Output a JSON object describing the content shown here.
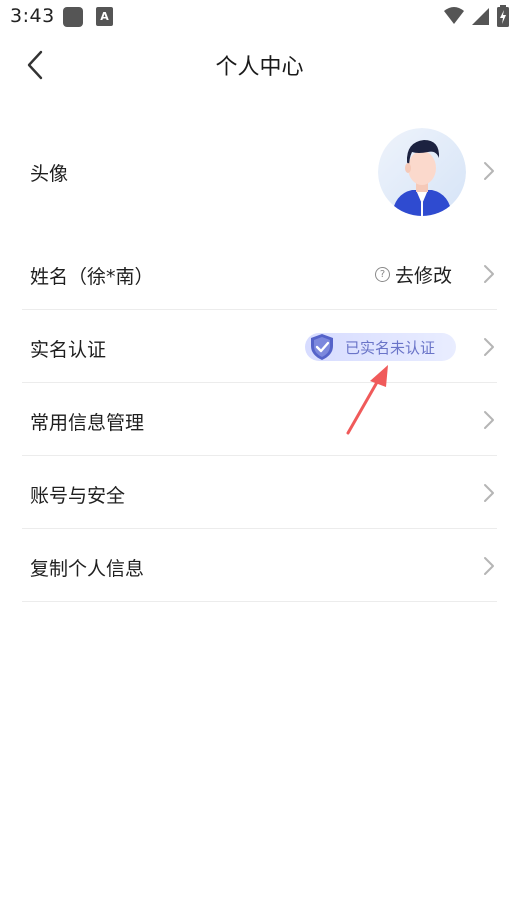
{
  "status_bar": {
    "time": "3:43",
    "icons": [
      "app-icon",
      "a-icon",
      "wifi-icon",
      "signal-icon",
      "battery-icon"
    ]
  },
  "header": {
    "title": "个人中心",
    "back_icon": "chevron-left-icon"
  },
  "rows": {
    "avatar": {
      "label": "头像"
    },
    "name": {
      "label": "姓名（徐*南）",
      "action": "去修改",
      "help_icon": "?"
    },
    "verification": {
      "label": "实名认证",
      "badge": "已实名未认证"
    },
    "common_info": {
      "label": "常用信息管理"
    },
    "account_security": {
      "label": "账号与安全"
    },
    "copy_info": {
      "label": "复制个人信息"
    }
  },
  "colors": {
    "background": "#ffffff",
    "divider": "#ececec",
    "badge_text": "#6a74c8",
    "badge_bg": "#dde2ff",
    "annotation_arrow": "#f05a5a"
  }
}
